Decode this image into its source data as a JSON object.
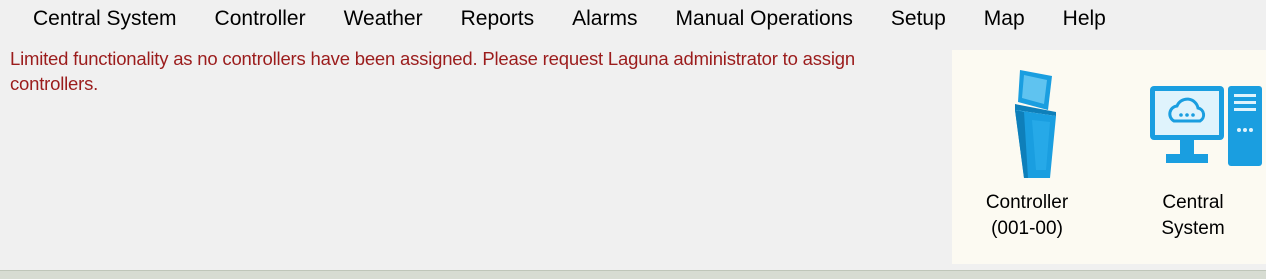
{
  "menu": {
    "items": [
      {
        "label": "Central System"
      },
      {
        "label": "Controller"
      },
      {
        "label": "Weather"
      },
      {
        "label": "Reports"
      },
      {
        "label": "Alarms"
      },
      {
        "label": "Manual Operations"
      },
      {
        "label": "Setup"
      },
      {
        "label": "Map"
      },
      {
        "label": "Help"
      }
    ]
  },
  "notice": {
    "text": "Limited functionality as no controllers have been assigned. Please request Laguna administrator to assign controllers.",
    "color": "#9b1c1c"
  },
  "tiles": [
    {
      "label": "Controller\n(001-00)",
      "icon": "controller-cabinet-icon"
    },
    {
      "label": "Central\nSystem",
      "icon": "central-system-computer-icon"
    }
  ],
  "colors": {
    "icon_blue": "#1a9ee0",
    "panel_bg": "#fcfaf2"
  }
}
